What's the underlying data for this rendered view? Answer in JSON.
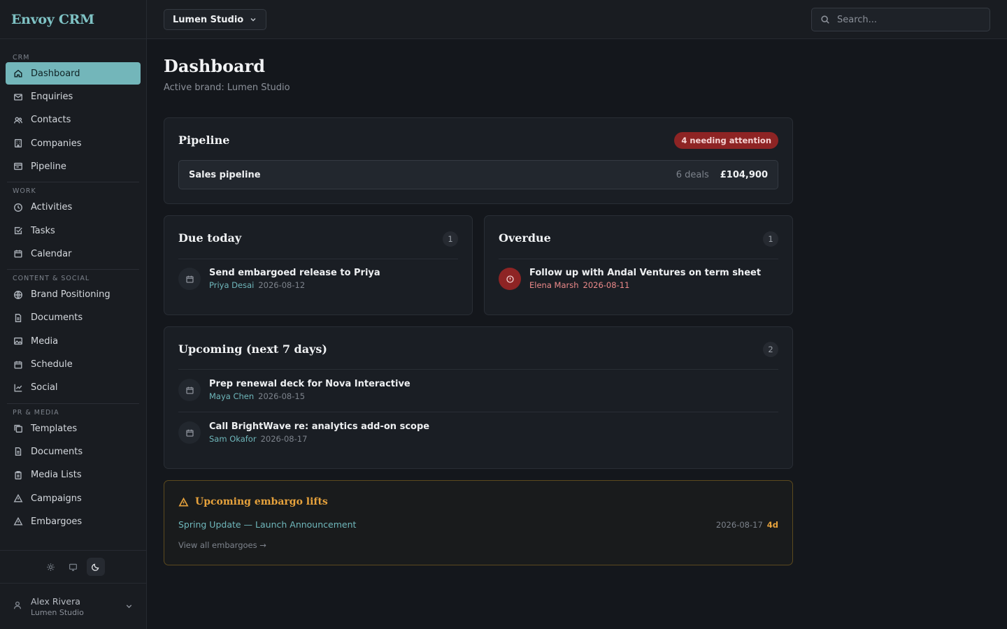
{
  "app": {
    "name": "Envoy CRM"
  },
  "topbar": {
    "brand_select": "Lumen Studio",
    "search_placeholder": "Search..."
  },
  "sidebar": {
    "sections": {
      "crm": "CRM",
      "work": "WORK",
      "content": "CONTENT & SOCIAL",
      "pr": "PR & MEDIA"
    },
    "items": {
      "dashboard": "Dashboard",
      "enquiries": "Enquiries",
      "contacts": "Contacts",
      "companies": "Companies",
      "pipeline": "Pipeline",
      "activities": "Activities",
      "tasks": "Tasks",
      "calendar": "Calendar",
      "brand_positioning": "Brand Positioning",
      "documents_content": "Documents",
      "media": "Media",
      "schedule": "Schedule",
      "social": "Social",
      "templates": "Templates",
      "documents_pr": "Documents",
      "media_lists": "Media Lists",
      "campaigns": "Campaigns",
      "embargoes": "Embargoes"
    },
    "active": "dashboard",
    "theme": {
      "options": [
        "light",
        "system",
        "dark"
      ],
      "selected": "dark"
    },
    "user": {
      "name": "Alex Rivera",
      "org": "Lumen Studio"
    }
  },
  "page": {
    "title": "Dashboard",
    "subtitle": "Active brand: Lumen Studio"
  },
  "pipeline": {
    "title": "Pipeline",
    "attention_badge": "4 needing attention",
    "row": {
      "name": "Sales pipeline",
      "deals": "6 deals",
      "value": "£104,900"
    }
  },
  "due_today": {
    "title": "Due today",
    "count": "1",
    "tasks": [
      {
        "title": "Send embargoed release to Priya",
        "owner": "Priya Desai",
        "date": "2026-08-12"
      }
    ]
  },
  "overdue": {
    "title": "Overdue",
    "count": "1",
    "tasks": [
      {
        "title": "Follow up with Andal Ventures on term sheet",
        "owner": "Elena Marsh",
        "date": "2026-08-11"
      }
    ]
  },
  "upcoming": {
    "title": "Upcoming (next 7 days)",
    "count": "2",
    "tasks": [
      {
        "title": "Prep renewal deck for Nova Interactive",
        "owner": "Maya Chen",
        "date": "2026-08-15"
      },
      {
        "title": "Call BrightWave re: analytics add-on scope",
        "owner": "Sam Okafor",
        "date": "2026-08-17"
      }
    ]
  },
  "embargo": {
    "title": "Upcoming embargo lifts",
    "item": {
      "name": "Spring Update — Launch Announcement",
      "date": "2026-08-17",
      "remaining": "4d"
    },
    "view_all": "View all embargoes →"
  },
  "colors": {
    "accent": "#73b6ba",
    "danger": "#8e2424",
    "warning": "#e6a23c"
  }
}
